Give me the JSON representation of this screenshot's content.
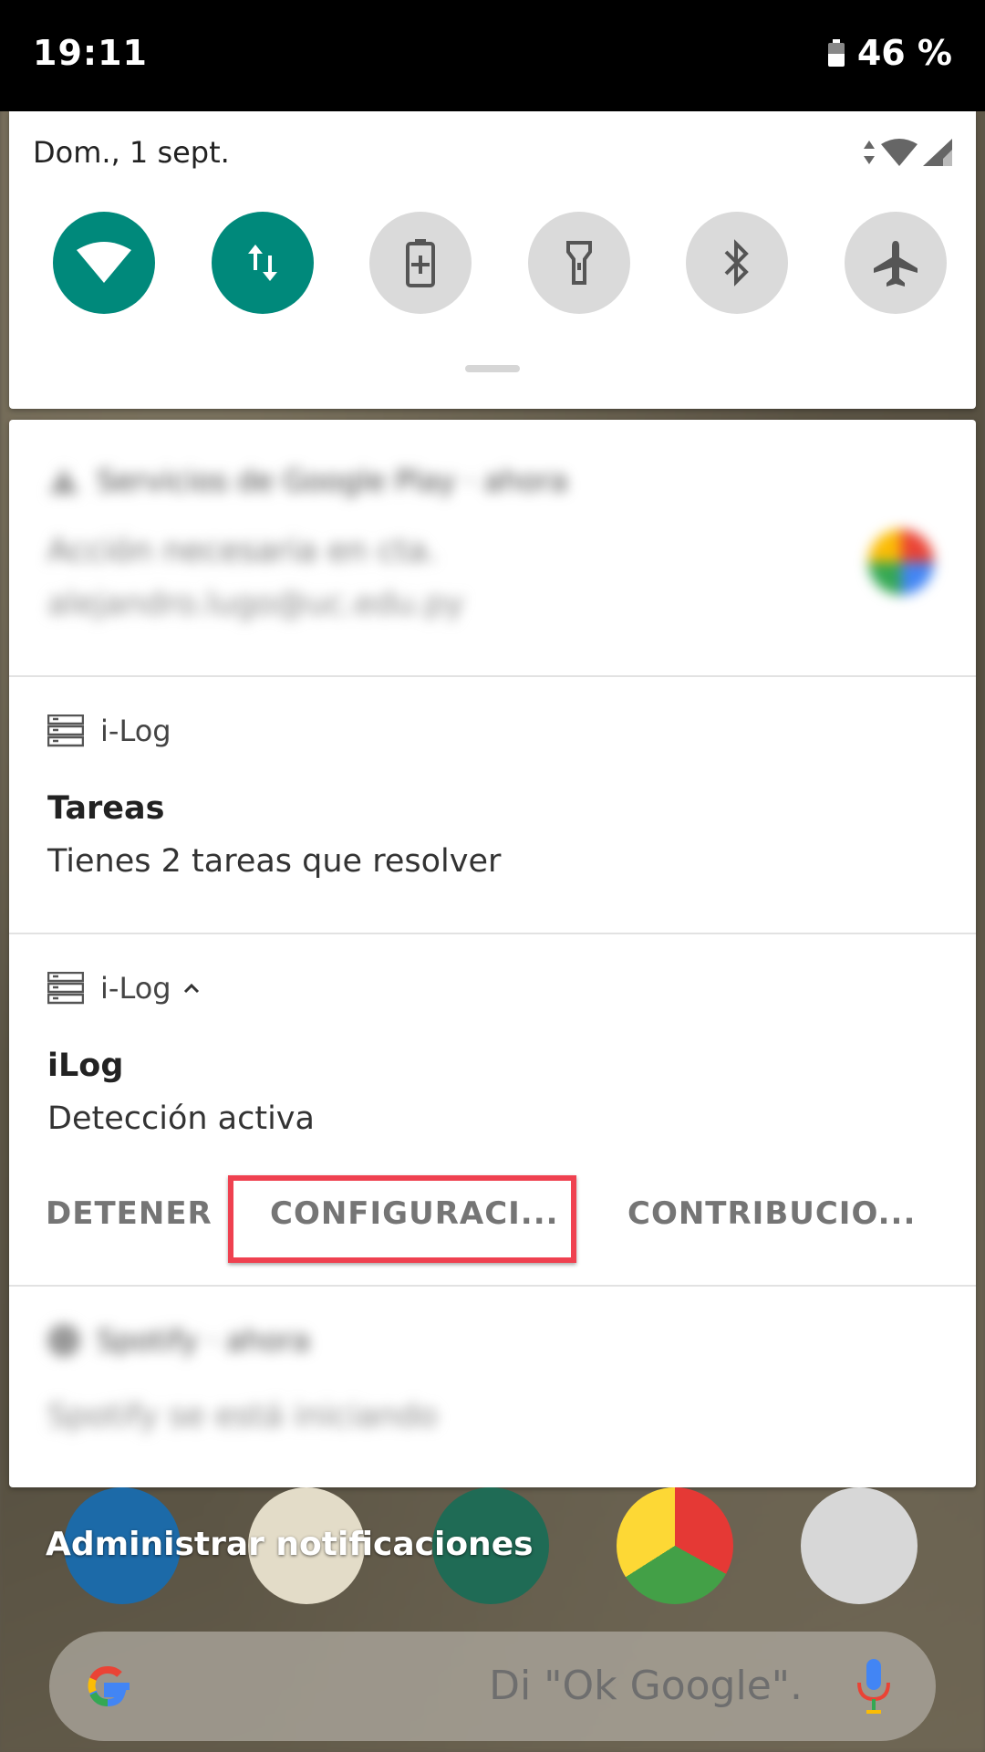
{
  "status_bar": {
    "time": "19:11",
    "battery": "46 %"
  },
  "quick_settings": {
    "date": "Dom., 1 sept.",
    "tiles": [
      {
        "name": "wifi",
        "active": true
      },
      {
        "name": "mobile-data",
        "active": true
      },
      {
        "name": "battery-saver",
        "active": false
      },
      {
        "name": "flashlight",
        "active": false
      },
      {
        "name": "bluetooth",
        "active": false
      },
      {
        "name": "airplane-mode",
        "active": false
      }
    ]
  },
  "notifications": [
    {
      "app": "Servicios de Google Play · ahora",
      "title": "Acción necesaria en cta.",
      "text": "alejandro.lugo@uc.edu.py",
      "blurred": true
    },
    {
      "app": "i-Log",
      "title": "Tareas",
      "text": "Tienes 2 tareas que resolver"
    },
    {
      "app": "i-Log",
      "title": "iLog",
      "text": "Detección activa",
      "actions": [
        "DETENER",
        "CONFIGURACI...",
        "CONTRIBUCIO..."
      ]
    },
    {
      "app": "Spotify · ahora",
      "text": "Spotify se está iniciando",
      "blurred": true
    }
  ],
  "manage_label": "Administrar notificaciones",
  "search": {
    "hint": "Di \"Ok Google\"."
  },
  "colors": {
    "accent": "#00897b",
    "highlight": "#ef4150"
  }
}
